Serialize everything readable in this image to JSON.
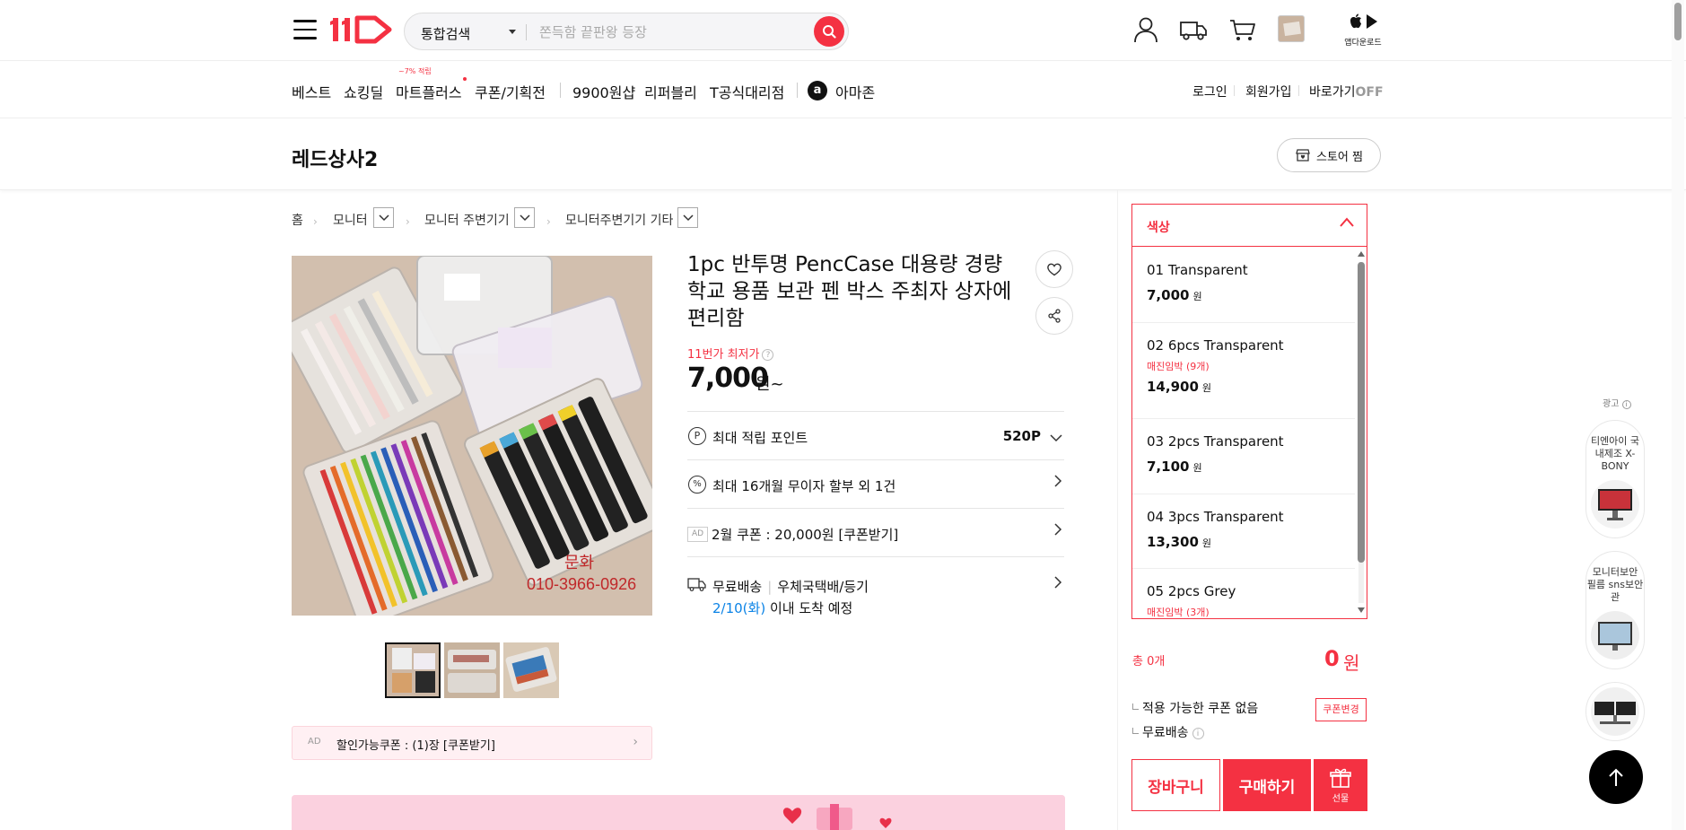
{
  "header": {
    "search_scope": "통합검색",
    "search_placeholder": "쫀득함 끝판왕 등장",
    "app_download": "앱다운로드"
  },
  "nav": {
    "items": [
      "베스트",
      "쇼킹딜",
      "마트플러스",
      "쿠폰/기획전",
      "9900원샵",
      "리퍼블리",
      "T공식대리점",
      "아마존"
    ],
    "mart_badge": "~7% 적립",
    "amazon_glyph": "a",
    "right": [
      "로그인",
      "회원가입",
      "바로가기"
    ],
    "shortcut_state": "OFF"
  },
  "store": {
    "name": "레드상사2",
    "like_label": "스토어 찜"
  },
  "breadcrumb": [
    "홈",
    "모니터",
    "모니터 주변기기",
    "모니터주변기기 기타"
  ],
  "product": {
    "title": "1pc 반투명 PencCase 대용량 경량 학교 용품 보관 펜 박스 주최자 상자에 편리함",
    "lowest_label": "11번가 최저가",
    "price": "7,000",
    "price_unit": "원~",
    "image_watermark_1": "문화",
    "image_watermark_2": "010-3966-0926",
    "points_label": "최대 적립 포인트",
    "points_value": "520P",
    "installment_label": "최대 16개월 무이자 할부 외 1건",
    "ad_tag": "AD",
    "coupon_label": "2월 쿠폰 : 20,000원 [쿠폰받기]",
    "shipping_free": "무료배송",
    "shipping_method": "우체국택배/등기",
    "delivery_date": "2/10(화)",
    "delivery_suffix": "이내 도착 예정",
    "discount_coupon": "할인가능쿠폰 : (1)장 [쿠폰받기]"
  },
  "options": {
    "header": "색상",
    "items": [
      {
        "name": "01 Transparent",
        "sub": "",
        "price": "7,000",
        "unit": "원"
      },
      {
        "name": "02 6pcs Transparent",
        "sub": "매진임박 (9개)",
        "price": "14,900",
        "unit": "원"
      },
      {
        "name": "03 2pcs Transparent",
        "sub": "",
        "price": "7,100",
        "unit": "원"
      },
      {
        "name": "04 3pcs Transparent",
        "sub": "",
        "price": "13,300",
        "unit": "원"
      },
      {
        "name": "05 2pcs Grey",
        "sub": "매진임박 (3개)",
        "price": "",
        "unit": ""
      }
    ]
  },
  "order": {
    "total_label": "총 0개",
    "total_value": "0",
    "total_unit": "원",
    "coupon_none": "적용 가능한 쿠폰 없음",
    "coupon_change": "쿠폰변경",
    "free_shipping": "무료배송",
    "cart_label": "장바구니",
    "buy_label": "구매하기",
    "gift_label": "선물"
  },
  "ads": {
    "label": "광고",
    "cards": [
      {
        "text": "티엔아이 국내제조 X-BONY"
      },
      {
        "text": "모니터보안 필름 sns보안관"
      }
    ]
  },
  "colors": {
    "brand_red": "#f43142",
    "blue": "#0b83e6"
  }
}
